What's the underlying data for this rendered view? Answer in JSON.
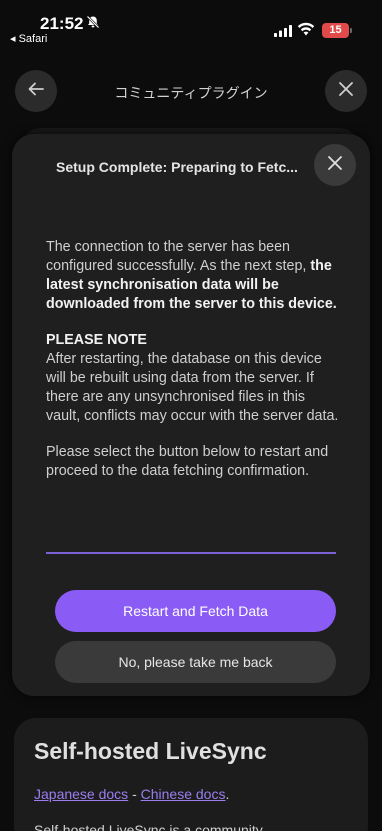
{
  "status_bar": {
    "time": "21:52",
    "back_app": "◂ Safari",
    "battery": "15",
    "battery_color": "#e14a4a"
  },
  "nav": {
    "title": "コミュニティプラグイン"
  },
  "modal": {
    "title": "Setup Complete: Preparing to Fetc...",
    "body_intro": "The connection to the server has been configured successfully. As the next step, ",
    "body_intro_bold": "the latest synchronisation data will be downloaded from the server to this device.",
    "note_heading": "PLEASE NOTE",
    "note_text": "After restarting, the database on this device will be rebuilt using data from the server. If there are any unsynchronised files in this vault, conflicts may occur with the server data.",
    "instruction": "Please select the button below to restart and proceed to the data fetching confirmation.",
    "primary_button": "Restart and Fetch Data",
    "secondary_button": "No, please take me back",
    "accent_color": "#8a5cf5"
  },
  "page": {
    "heading": "Self-hosted LiveSync",
    "link_japanese": "Japanese docs",
    "separator": " - ",
    "link_chinese": "Chinese docs",
    "after_links": ".",
    "cut_text": "Self-hosted LiveSync is a community"
  }
}
